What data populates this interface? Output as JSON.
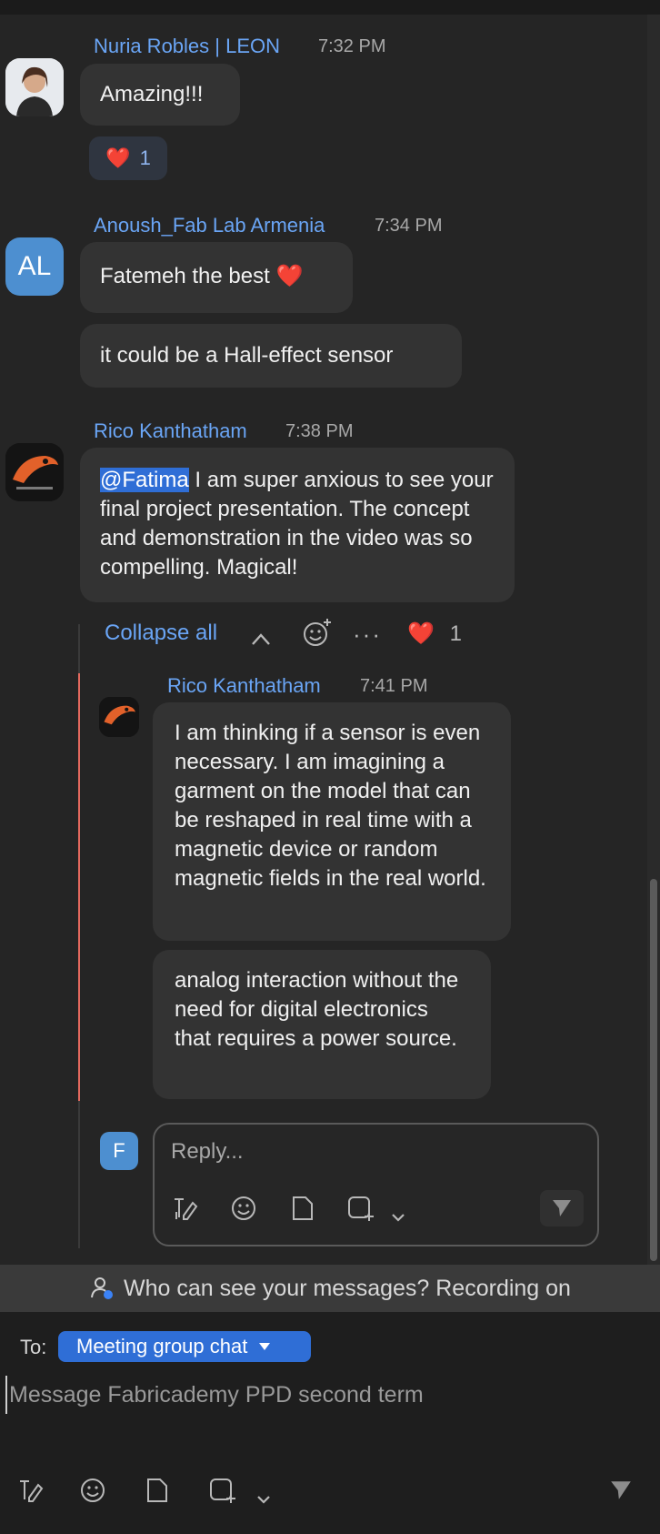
{
  "messages": [
    {
      "author": "Nuria Robles | LEON",
      "time": "7:32 PM",
      "texts": [
        "Amazing!!!"
      ],
      "reaction": {
        "emoji": "❤️",
        "count": "1"
      }
    },
    {
      "author": "Anoush_Fab Lab Armenia",
      "avatar_initials": "AL",
      "time": "7:34 PM",
      "texts": [
        "Fatemeh the best",
        "it could be a Hall-effect sensor"
      ],
      "text1_emoji": "❤️"
    },
    {
      "author": "Rico Kanthatham",
      "time": "7:38 PM",
      "mention": "@Fatima",
      "text_after_mention": " I am super anxious to see your final project presentation. The concept and demonstration in the video was so compelling. Magical!"
    }
  ],
  "thread": {
    "collapse_label": "Collapse all",
    "reaction": {
      "emoji": "❤️",
      "count": "1"
    },
    "reply": {
      "author": "Rico Kanthatham",
      "time": "7:41 PM",
      "texts": [
        "I am thinking if a sensor is even necessary. I am imagining a garment on the model that can be reshaped in real time with a magnetic device or random magnetic fields in the real world.",
        "analog interaction without the need for digital electronics that requires a power source."
      ]
    },
    "composer": {
      "avatar_initial": "F",
      "placeholder": "Reply..."
    }
  },
  "visibility_notice": "Who can see your messages? Recording on",
  "composer": {
    "to_label": "To:",
    "recipient": "Meeting group chat",
    "placeholder": "Message Fabricademy PPD second term"
  },
  "icons": [
    "format-icon",
    "emoji-icon",
    "file-icon",
    "screenshot-icon",
    "chevron-down-icon",
    "send-icon",
    "ellipsis-icon",
    "add-reaction-icon",
    "chevron-up-icon",
    "person-lock-icon"
  ],
  "colors": {
    "accent": "#2f6ed6",
    "link": "#6aa5f5",
    "thread_bar": "#e4695e"
  }
}
